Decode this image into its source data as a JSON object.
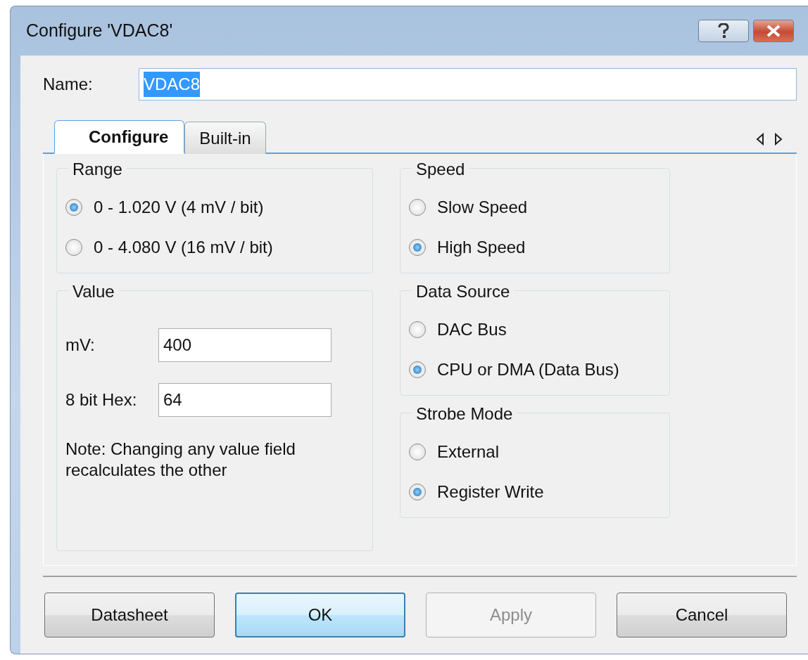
{
  "window": {
    "title": "Configure 'VDAC8'"
  },
  "name_field": {
    "label": "Name:",
    "value": "VDAC8",
    "text_selected": true
  },
  "tabs": [
    {
      "label": "Configure",
      "selected": true
    },
    {
      "label": "Built-in",
      "selected": false
    }
  ],
  "columns": [
    [
      {
        "title": "Range",
        "kind": "radio",
        "options": [
          {
            "label": "0 - 1.020 V (4 mV / bit)",
            "selected": true
          },
          {
            "label": "0 - 4.080 V (16 mV / bit)",
            "selected": false
          }
        ]
      },
      {
        "title": "Value",
        "kind": "fields",
        "fields": [
          {
            "label": "mV:",
            "value": "400"
          },
          {
            "label": "8 bit Hex:",
            "value": "64"
          }
        ],
        "note": "Note: Changing any value field recalculates the other"
      }
    ],
    [
      {
        "title": "Speed",
        "kind": "radio",
        "options": [
          {
            "label": "Slow Speed",
            "selected": false
          },
          {
            "label": "High Speed",
            "selected": true
          }
        ]
      },
      {
        "title": "Data Source",
        "kind": "radio",
        "options": [
          {
            "label": "DAC Bus",
            "selected": false
          },
          {
            "label": "CPU or DMA (Data Bus)",
            "selected": true
          }
        ]
      },
      {
        "title": "Strobe Mode",
        "kind": "radio",
        "options": [
          {
            "label": "External",
            "selected": false
          },
          {
            "label": "Register Write",
            "selected": true
          }
        ]
      }
    ]
  ],
  "buttons": [
    {
      "label": "Datasheet",
      "disabled": false,
      "default": false
    },
    {
      "label": "OK",
      "disabled": false,
      "default": true
    },
    {
      "label": "Apply",
      "disabled": true,
      "default": false
    },
    {
      "label": "Cancel",
      "disabled": false,
      "default": false
    }
  ]
}
